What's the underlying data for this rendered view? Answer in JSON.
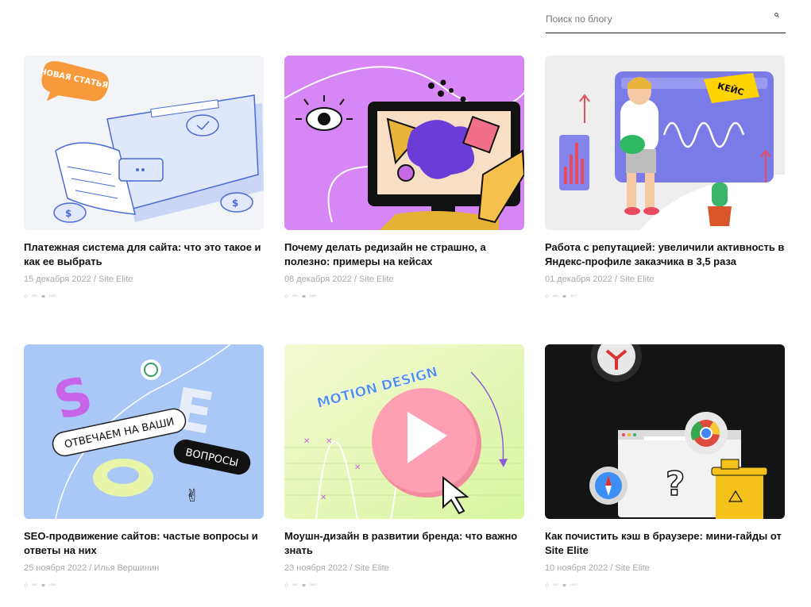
{
  "search": {
    "placeholder": "Поиск по блогу"
  },
  "posts": [
    {
      "title": "Платежная система для сайта: что это такое и как ее выбрать",
      "date": "15 декабря 2022",
      "author": "Site Elite",
      "views": "250",
      "comments": "1200",
      "badge": "НОВАЯ СТАТЬЯ!"
    },
    {
      "title": "Почему делать редизайн не страшно, а полезно: примеры на кейсах",
      "date": "08 декабря 2022",
      "author": "Site Elite",
      "views": "300",
      "comments": "1080"
    },
    {
      "title": "Работа с репутацией: увеличили активность в Яндекс-профиле заказчика в 3,5 раза",
      "date": "01 декабря 2022",
      "author": "Site Elite",
      "views": "280",
      "comments": "3077",
      "badge": "КЕЙС"
    },
    {
      "title": "SEO-продвижение сайтов: частые вопросы и ответы на них",
      "date": "25 ноября 2022",
      "author": "Илья Вершинин",
      "views": "250",
      "comments": "1300",
      "banner1": "ОТВЕЧАЕМ НА ВАШИ",
      "banner2": "ВОПРОСЫ"
    },
    {
      "title": "Моушн-дизайн в развитии бренда: что важно знать",
      "date": "23 ноября 2022",
      "author": "Site Elite",
      "views": "490",
      "comments": "2600",
      "label": "MOTION DESIGN"
    },
    {
      "title": "Как почистить кэш в браузере: мини-гайды от Site Elite",
      "date": "10 ноября 2022",
      "author": "Site Elite",
      "views": "220",
      "comments": "1020"
    }
  ]
}
